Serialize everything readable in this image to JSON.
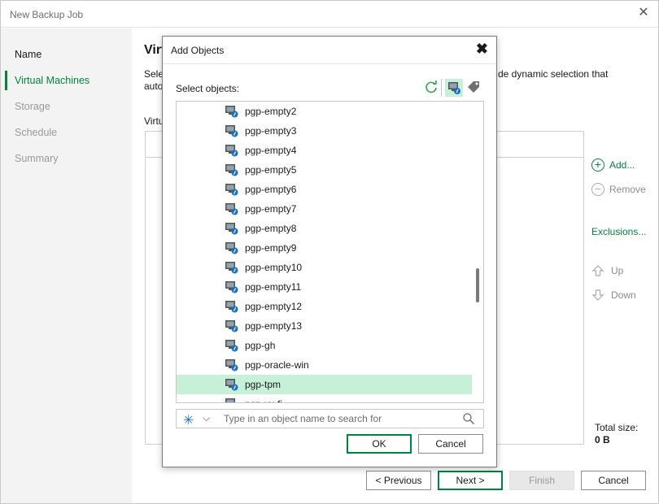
{
  "window": {
    "title": "New Backup Job",
    "close_glyph": "✕"
  },
  "sidebar": {
    "items": [
      {
        "label": "Name",
        "state": "done"
      },
      {
        "label": "Virtual Machines",
        "state": "active"
      },
      {
        "label": "Storage",
        "state": "pending"
      },
      {
        "label": "Schedule",
        "state": "pending"
      },
      {
        "label": "Summary",
        "state": "pending"
      }
    ]
  },
  "main": {
    "heading": "Virt",
    "desc_left": "Sele\nauto",
    "desc_right": "de dynamic selection that",
    "vm_label": "Virtu",
    "buttons": {
      "add": "Add...",
      "remove": "Remove",
      "exclusions": "Exclusions...",
      "up": "Up",
      "down": "Down"
    },
    "total_label": "Total size:",
    "total_value": "0 B"
  },
  "footer": {
    "previous": "< Previous",
    "next": "Next >",
    "finish": "Finish",
    "cancel": "Cancel"
  },
  "modal": {
    "title": "Add Objects",
    "close_glyph": "✖",
    "select_label": "Select objects:",
    "toolbar_icons": [
      "refresh-icon",
      "vm-view-icon",
      "tag-icon"
    ],
    "items": [
      {
        "name": "pgp-empty2",
        "selected": false
      },
      {
        "name": "pgp-empty3",
        "selected": false
      },
      {
        "name": "pgp-empty4",
        "selected": false
      },
      {
        "name": "pgp-empty5",
        "selected": false
      },
      {
        "name": "pgp-empty6",
        "selected": false
      },
      {
        "name": "pgp-empty7",
        "selected": false
      },
      {
        "name": "pgp-empty8",
        "selected": false
      },
      {
        "name": "pgp-empty9",
        "selected": false
      },
      {
        "name": "pgp-empty10",
        "selected": false
      },
      {
        "name": "pgp-empty11",
        "selected": false
      },
      {
        "name": "pgp-empty12",
        "selected": false
      },
      {
        "name": "pgp-empty13",
        "selected": false
      },
      {
        "name": "pgp-gh",
        "selected": false
      },
      {
        "name": "pgp-oracle-win",
        "selected": false
      },
      {
        "name": "pgp-tpm",
        "selected": true
      },
      {
        "name": "pgp-xx-fi",
        "selected": false
      }
    ],
    "search_placeholder": "Type in an object name to search for",
    "ok": "OK",
    "cancel": "Cancel"
  },
  "colors": {
    "accent": "#00843d",
    "selection": "#c7f0d8",
    "sidebar_bg": "#f3f3f3"
  }
}
